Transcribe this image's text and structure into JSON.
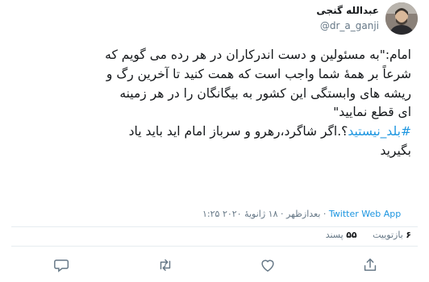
{
  "author": {
    "display_name": "عبدالله گنجی",
    "handle": "@dr_a_ganji"
  },
  "tweet": {
    "line1": "امام:\"به مسئولین و دست اندرکاران در هر رده می گویم که",
    "line2": "شرعاً بر همهٔ شما واجب است که همت کنید تا آخرین رگ و",
    "line3": "ریشه های وابستگی این کشور به بیگانگان را در هر زمینه",
    "line4": "ای قطع نمایید\"",
    "hashtag": "#بلد_نیستید",
    "line5_rest": "؟.اگر شاگرد،رهرو و سرباز امام اید باید یاد",
    "line6": "بگیرید"
  },
  "meta": {
    "time": "۱:۲۵ بعدازظهر",
    "date": "۱۸ ژانویهٔ ۲۰۲۰",
    "separator": "·",
    "source": "Twitter Web App"
  },
  "stats": {
    "retweet_count": "۶",
    "retweet_label": "بازتوییت",
    "like_count": "۵۵",
    "like_label": "پسند"
  },
  "actions": {
    "icons": [
      "reply-icon",
      "retweet-icon",
      "like-icon",
      "share-icon"
    ]
  },
  "colors": {
    "link": "#1b95e0",
    "text": "#14171a",
    "muted": "#657786",
    "divider": "#e6ecf0"
  }
}
